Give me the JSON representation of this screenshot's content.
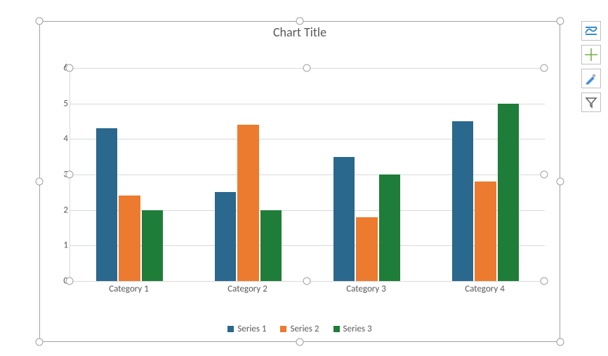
{
  "chart_data": {
    "type": "bar",
    "title": "Chart Title",
    "categories": [
      "Category 1",
      "Category 2",
      "Category 3",
      "Category 4"
    ],
    "series": [
      {
        "name": "Series 1",
        "color": "#2A688E",
        "values": [
          4.3,
          2.5,
          3.5,
          4.5
        ]
      },
      {
        "name": "Series 2",
        "color": "#EC7A2F",
        "values": [
          2.4,
          4.4,
          1.8,
          2.8
        ]
      },
      {
        "name": "Series 3",
        "color": "#1E7D38",
        "values": [
          2.0,
          2.0,
          3.0,
          5.0
        ]
      }
    ],
    "ylim": [
      0,
      6
    ],
    "yticks": [
      0,
      1,
      2,
      3,
      4,
      5,
      6
    ],
    "xlabel": "",
    "ylabel": ""
  },
  "tools": {
    "chart_elements": "chart-elements",
    "styles": "chart-styles",
    "format": "chart-format",
    "filter": "chart-filter"
  }
}
